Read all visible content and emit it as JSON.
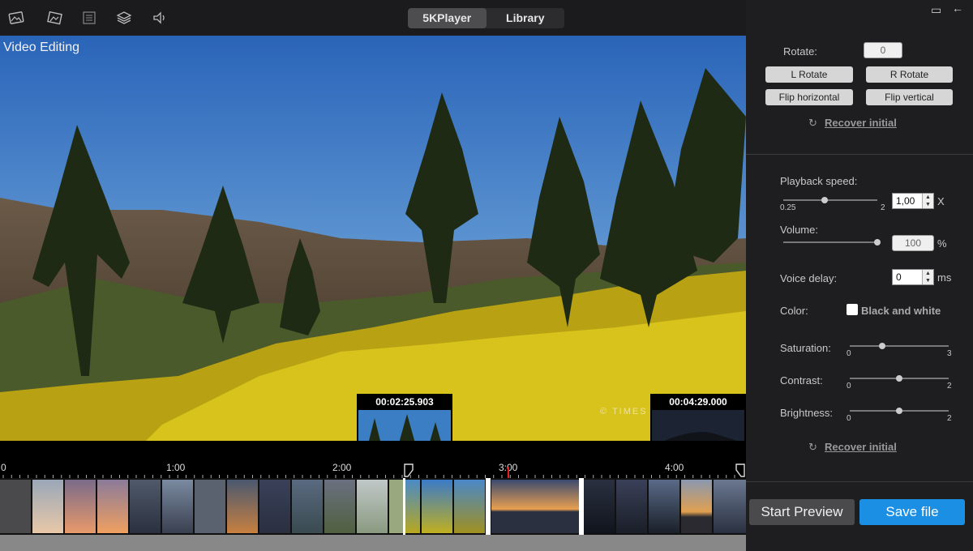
{
  "toolbar": {
    "icons": [
      "image-icon",
      "image-edit-icon",
      "list-icon",
      "layers-icon",
      "speaker-icon"
    ],
    "tabs": [
      {
        "label": "5KPlayer",
        "active": true
      },
      {
        "label": "Library",
        "active": false
      }
    ]
  },
  "video": {
    "title": "Video Editing",
    "watermark": "© TIMES"
  },
  "timeline": {
    "thumb_start_time": "00:02:25.903",
    "thumb_end_time": "00:04:29.000",
    "ruler_labels": [
      "0",
      "1:00",
      "2:00",
      "3:00",
      "4:00"
    ],
    "playhead_color": "#e02020"
  },
  "panel": {
    "window_controls": [
      "restore-icon",
      "back-arrow-icon"
    ],
    "rotate_label": "Rotate:",
    "rotate_value": "0",
    "l_rotate": "L Rotate",
    "r_rotate": "R Rotate",
    "flip_h": "Flip horizontal",
    "flip_v": "Flip vertical",
    "recover": "Recover initial",
    "playback_label": "Playback speed:",
    "speed_min": "0.25",
    "speed_max": "2",
    "speed_value": "1,00",
    "speed_unit": "X",
    "speed_level": 0.44,
    "volume_label": "Volume:",
    "volume_value": "100",
    "volume_unit": "%",
    "volume_level": 1.0,
    "voice_delay_label": "Voice delay:",
    "voice_delay_value": "0",
    "voice_delay_unit": "ms",
    "color_label": "Color:",
    "bw_label": "Black and white",
    "saturation_label": "Saturation:",
    "saturation_min": "0",
    "saturation_max": "3",
    "saturation_level": 0.33,
    "contrast_label": "Contrast:",
    "contrast_min": "0",
    "contrast_max": "2",
    "contrast_level": 0.5,
    "brightness_label": "Brightness:",
    "brightness_min": "0",
    "brightness_max": "2",
    "brightness_level": 0.5,
    "recover2": "Recover initial",
    "start_preview": "Start Preview",
    "save_file": "Save file"
  },
  "colors": {
    "save_button": "#1a8fe3",
    "preview_button": "#4a4a4d",
    "panel_bg": "#1e1e20"
  }
}
